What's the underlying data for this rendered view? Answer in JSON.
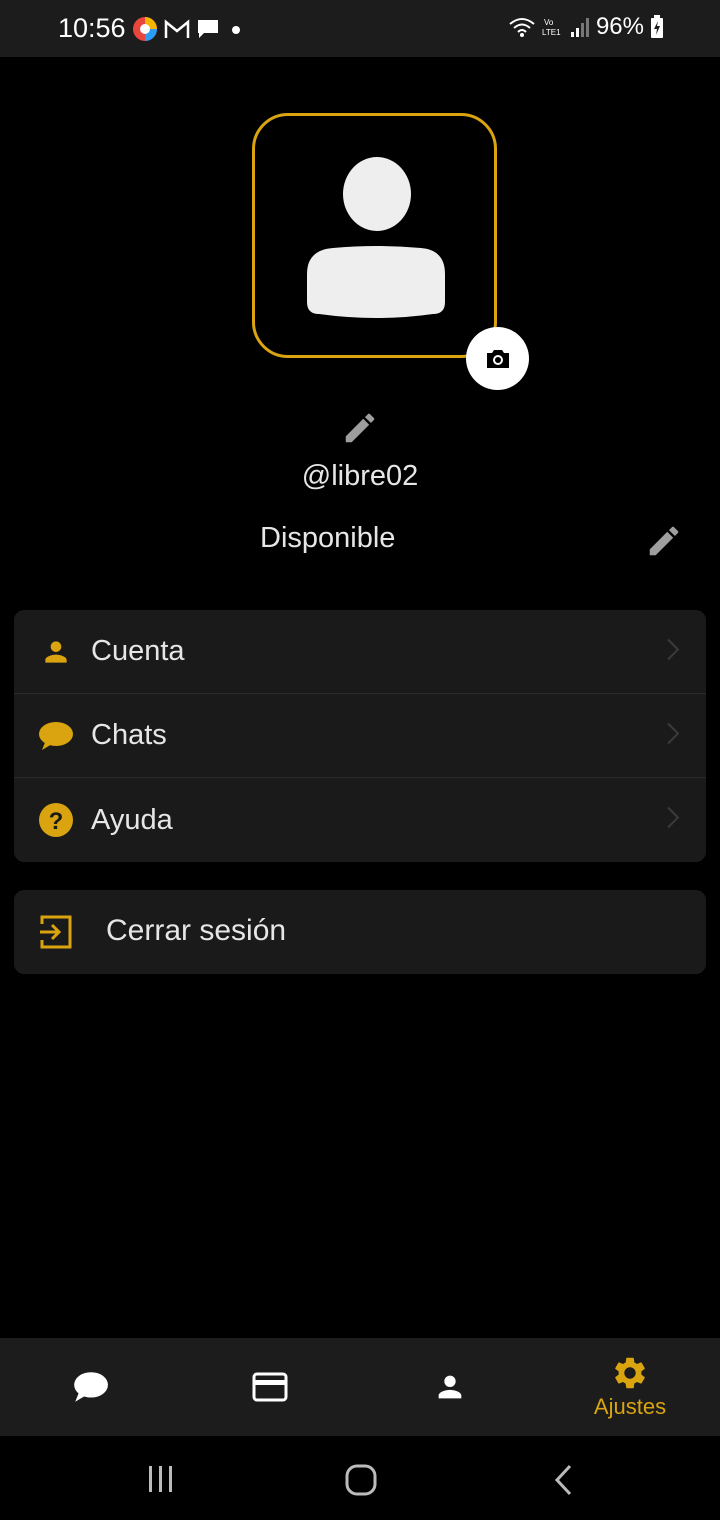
{
  "status_bar": {
    "time": "10:56",
    "battery": "96%"
  },
  "profile": {
    "username": "@libre02",
    "status": "Disponible"
  },
  "menu": {
    "items": [
      {
        "label": "Cuenta",
        "icon": "person-icon"
      },
      {
        "label": "Chats",
        "icon": "chat-bubble-icon"
      },
      {
        "label": "Ayuda",
        "icon": "help-icon"
      }
    ],
    "logout_label": "Cerrar sesión"
  },
  "bottom_nav": {
    "items": [
      {
        "name": "chats",
        "icon": "chat-bubble-icon",
        "label": ""
      },
      {
        "name": "payments",
        "icon": "card-icon",
        "label": ""
      },
      {
        "name": "contacts",
        "icon": "person-icon",
        "label": ""
      },
      {
        "name": "settings",
        "icon": "gear-icon",
        "label": "Ajustes",
        "active": true
      }
    ]
  },
  "colors": {
    "accent": "#d9a40f",
    "background": "#000000",
    "card": "#1a1a1a"
  }
}
